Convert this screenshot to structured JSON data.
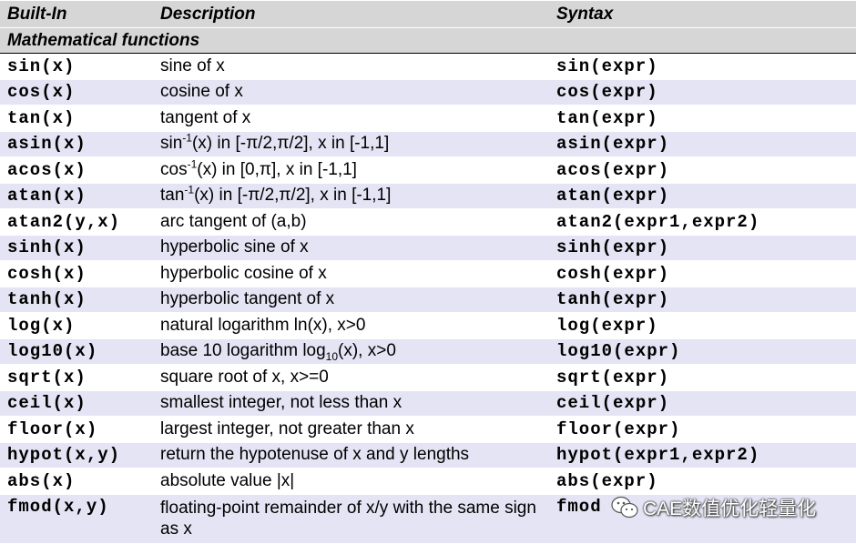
{
  "header": {
    "col1": "Built-In",
    "col2": "Description",
    "col3": "Syntax"
  },
  "section_title": "Mathematical functions",
  "rows": [
    {
      "builtin": "sin(x)",
      "desc": "sine of x",
      "syntax": "sin(expr)"
    },
    {
      "builtin": "cos(x)",
      "desc": "cosine of x",
      "syntax": "cos(expr)"
    },
    {
      "builtin": "tan(x)",
      "desc": "tangent of x",
      "syntax": "tan(expr)"
    },
    {
      "builtin": "asin(x)",
      "desc_pre": "sin",
      "desc_sup": "-1",
      "desc_post": "(x) in [-π/2,π/2], x in [-1,1]",
      "syntax": "asin(expr)"
    },
    {
      "builtin": "acos(x)",
      "desc_pre": "cos",
      "desc_sup": "-1",
      "desc_post": "(x) in [0,π], x in [-1,1]",
      "syntax": "acos(expr)"
    },
    {
      "builtin": "atan(x)",
      "desc_pre": "tan",
      "desc_sup": "-1",
      "desc_post": "(x) in [-π/2,π/2], x in [-1,1]",
      "syntax": "atan(expr)"
    },
    {
      "builtin": "atan2(y,x)",
      "desc": "arc tangent of (a,b)",
      "syntax": "atan2(expr1,expr2)"
    },
    {
      "builtin": "sinh(x)",
      "desc": "hyperbolic sine of x",
      "syntax": "sinh(expr)"
    },
    {
      "builtin": "cosh(x)",
      "desc": "hyperbolic cosine of x",
      "syntax": "cosh(expr)"
    },
    {
      "builtin": "tanh(x)",
      "desc": "hyperbolic tangent of x",
      "syntax": "tanh(expr)"
    },
    {
      "builtin": "log(x)",
      "desc": "natural logarithm ln(x), x>0",
      "syntax": "log(expr)"
    },
    {
      "builtin": "log10(x)",
      "desc_pre": "base 10 logarithm log",
      "desc_sub": "10",
      "desc_post": "(x), x>0",
      "syntax": "log10(expr)"
    },
    {
      "builtin": "sqrt(x)",
      "desc": "square root of x, x>=0",
      "syntax": "sqrt(expr)"
    },
    {
      "builtin": "ceil(x)",
      "desc": "smallest integer, not less than x",
      "syntax": "ceil(expr)"
    },
    {
      "builtin": "floor(x)",
      "desc": "largest integer, not greater than x",
      "syntax": "floor(expr)"
    },
    {
      "builtin": "hypot(x,y)",
      "desc": "return the hypotenuse of x and y lengths",
      "syntax": "hypot(expr1,expr2)"
    },
    {
      "builtin": "abs(x)",
      "desc": "absolute value |x|",
      "syntax": "abs(expr)"
    },
    {
      "builtin": "fmod(x,y)",
      "desc": "floating-point remainder of x/y with the same sign as x",
      "syntax": "fmod"
    }
  ],
  "watermark": {
    "text": "CAE数值优化轻量化",
    "icon": "wechat-icon"
  },
  "colors": {
    "header_bg": "#d6d6d6",
    "alt_row_bg": "#e4e4f4",
    "plain_row_bg": "#ffffff"
  }
}
